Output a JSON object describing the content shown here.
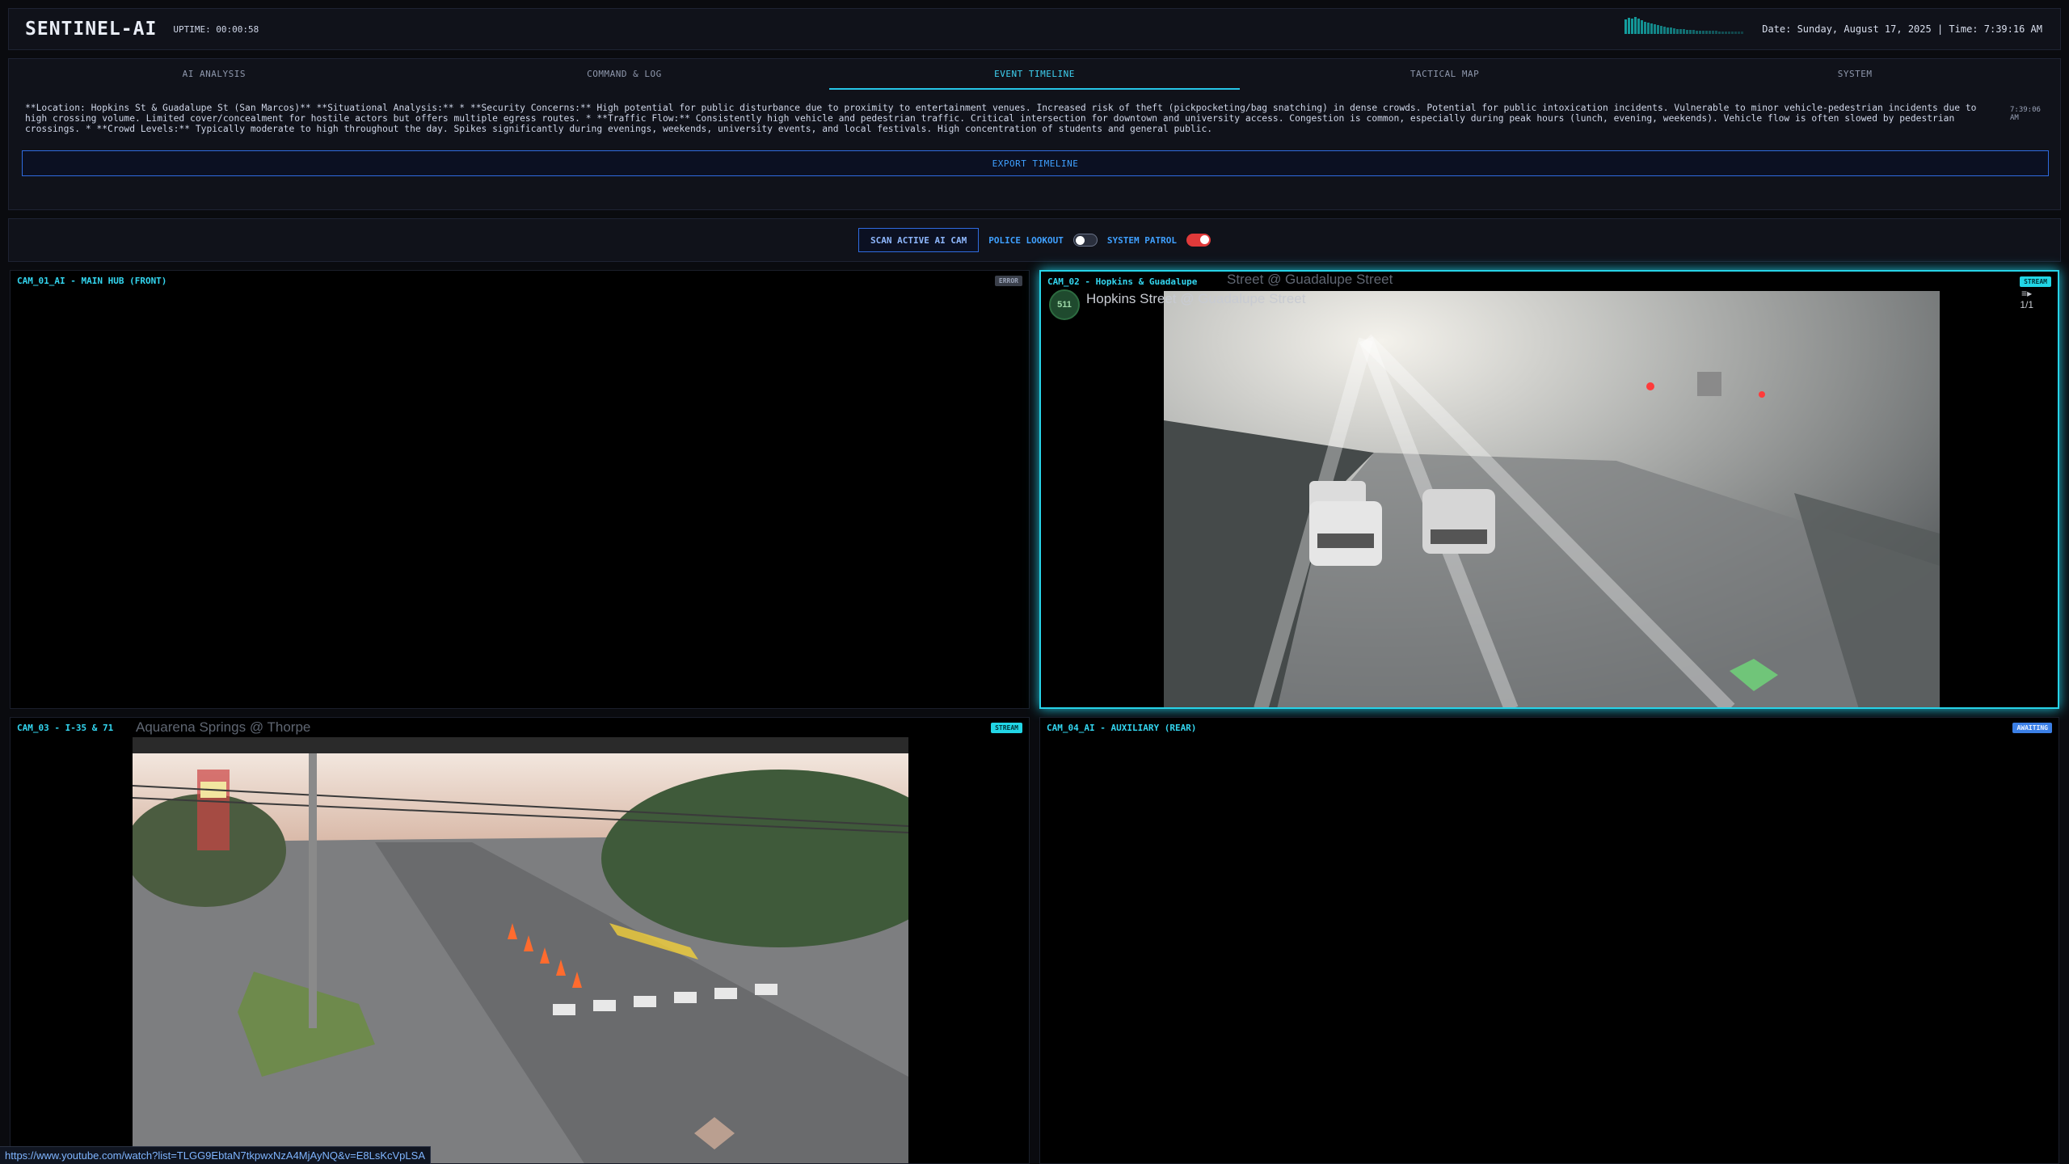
{
  "header": {
    "title": "SENTINEL-AI",
    "uptime": "UPTIME: 00:00:58",
    "datetime": "Date: Sunday, August 17, 2025 | Time: 7:39:16 AM"
  },
  "tabs": [
    {
      "label": "AI ANALYSIS",
      "active": false
    },
    {
      "label": "COMMAND & LOG",
      "active": false
    },
    {
      "label": "EVENT TIMELINE",
      "active": true
    },
    {
      "label": "TACTICAL MAP",
      "active": false
    },
    {
      "label": "SYSTEM",
      "active": false
    }
  ],
  "timeline": {
    "entry_text": "**Location: Hopkins St & Guadalupe St (San Marcos)** **Situational Analysis:** * **Security Concerns:** High potential for public disturbance due to proximity to entertainment venues. Increased risk of theft (pickpocketing/bag snatching) in dense crowds. Potential for public intoxication incidents. Vulnerable to minor vehicle-pedestrian incidents due to high crossing volume. Limited cover/concealment for hostile actors but offers multiple egress routes. * **Traffic Flow:** Consistently high vehicle and pedestrian traffic. Critical intersection for downtown and university access. Congestion is common, especially during peak hours (lunch, evening, weekends). Vehicle flow is often slowed by pedestrian crossings. * **Crowd Levels:** Typically moderate to high throughout the day. Spikes significantly during evenings, weekends, university events, and local festivals. High concentration of students and general public.",
    "entry_time": "7:39:06 AM",
    "export_label": "EXPORT TIMELINE"
  },
  "controls": {
    "scan_label": "SCAN ACTIVE AI CAM",
    "police_label": "POLICE LOOKOUT",
    "police_on": false,
    "patrol_label": "SYSTEM PATROL",
    "patrol_on": true
  },
  "cams": [
    {
      "label": "CAM_01_AI - MAIN HUB (FRONT)",
      "status": "ERROR"
    },
    {
      "label": "CAM_02 - Hopkins & Guadalupe",
      "status": "STREAM",
      "overlay_title": "Street @ Guadalupe Street",
      "video_title": "Hopkins Street @ Guadalupe Street",
      "channel_initials": "511",
      "counter": "1/1"
    },
    {
      "label": "CAM_03 - I-35 & 71",
      "status": "STREAM",
      "overlay_title": "Aquarena Springs @ Thorpe"
    },
    {
      "label": "CAM_04_AI - AUXILIARY (REAR)",
      "status": "AWAITING"
    }
  ],
  "signal_levels": [
    0.55,
    0.62,
    0.58,
    0.66,
    0.6,
    0.52,
    0.48,
    0.44,
    0.4,
    0.36,
    0.33,
    0.3,
    0.28,
    0.26,
    0.24,
    0.22,
    0.2,
    0.2,
    0.18,
    0.17,
    0.16,
    0.15,
    0.14,
    0.14,
    0.13,
    0.12,
    0.12,
    0.11,
    0.11,
    0.1,
    0.1,
    0.1,
    0.09,
    0.09,
    0.09,
    0.08,
    0.08
  ],
  "status_url": "https://www.youtube.com/watch?list=TLGG9EbtaN7tkpwxNzA4MjAyNQ&v=E8LsKcVpLSA"
}
